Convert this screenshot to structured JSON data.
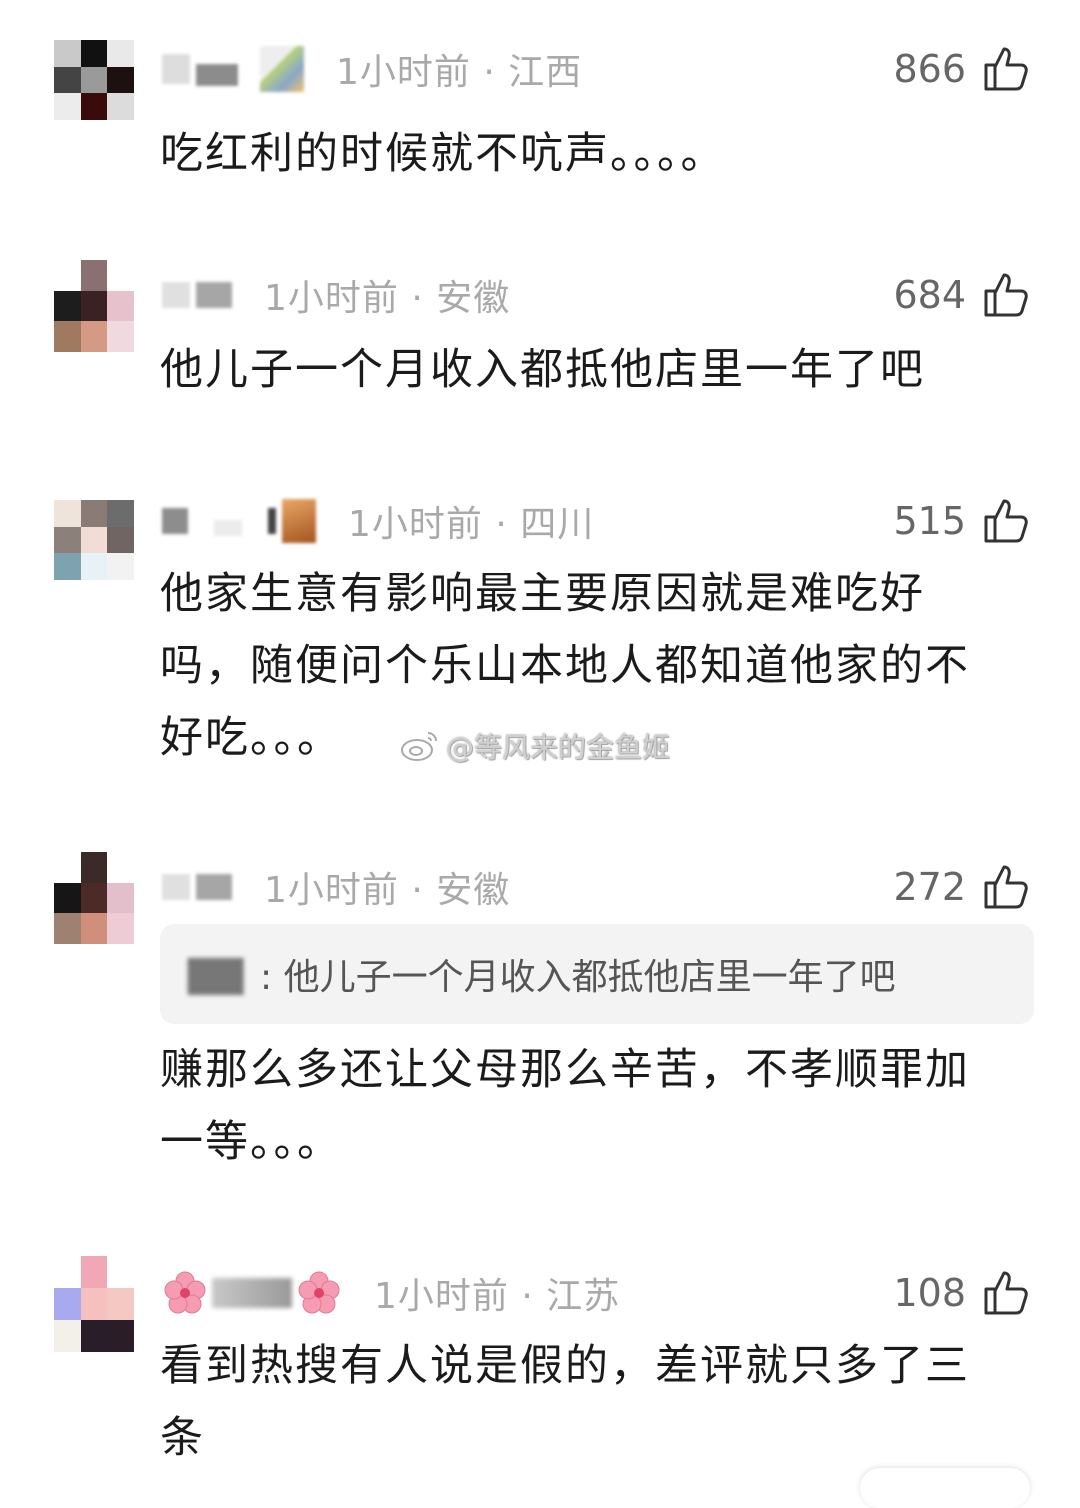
{
  "comments": [
    {
      "time_loc": "1小时前 · 江西",
      "likes": "866",
      "text": "吃红利的时候就不吭声。。。。"
    },
    {
      "time_loc": "1小时前 · 安徽",
      "likes": "684",
      "text": "他儿子一个月收入都抵他店里一年了吧"
    },
    {
      "time_loc": "1小时前 · 四川",
      "likes": "515",
      "text_lines": [
        "他家生意有影响最主要原因就是难吃好",
        "吗，随便问个乐山本地人都知道他家的不",
        "好吃。。。"
      ]
    },
    {
      "time_loc": "1小时前 · 安徽",
      "likes": "272",
      "quote_text": ": 他儿子一个月收入都抵他店里一年了吧",
      "text_lines": [
        "赚那么多还让父母那么辛苦，不孝顺罪加",
        "一等。。。"
      ]
    },
    {
      "time_loc": "1小时前 · 江苏",
      "likes": "108",
      "text_lines": [
        "看到热搜有人说是假的，差评就只多了三",
        "条"
      ]
    }
  ],
  "watermark": "@等风来的金鱼姬",
  "icons": {
    "like": "thumbs-up-icon",
    "watermark_logo": "weibo-logo-icon",
    "flower": "cherry-blossom-icon"
  },
  "colors": {
    "meta_gray": "#a9a9a9",
    "like_count": "#666666",
    "quote_bg": "#f3f3f3"
  }
}
